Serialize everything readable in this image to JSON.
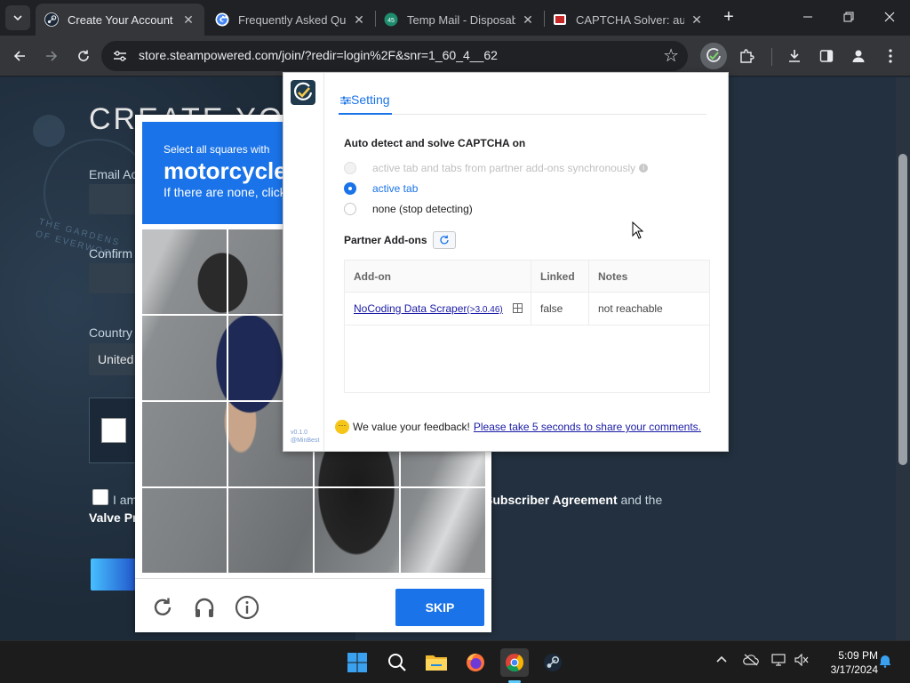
{
  "browser": {
    "tabs": [
      {
        "title": "Create Your Account",
        "active": true
      },
      {
        "title": "Frequently Asked Que",
        "active": false
      },
      {
        "title": "Temp Mail - Disposab",
        "active": false
      },
      {
        "title": "CAPTCHA Solver: auto",
        "active": false
      }
    ],
    "new_tab_symbol": "+",
    "url": "store.steampowered.com/join/?redir=login%2F&snr=1_60_4__62"
  },
  "page": {
    "title": "CREATE YOU",
    "email_label": "Email Ac",
    "confirm_label": "Confirm",
    "country_label": "Country",
    "country_value": "United",
    "agree_prefix": "I am",
    "agree_middle": "Subscriber Agreement",
    "agree_suffix": "and the",
    "agree_line2": "Valve Pr",
    "watermark": "THE GARDENS OF EVERWOOD"
  },
  "hcaptcha": {
    "prompt_small": "Select all squares with",
    "prompt_object": "motorcycle",
    "prompt_hint": "If there are none, click",
    "skip_label": "SKIP"
  },
  "extension": {
    "tab_label": "Setting",
    "version": "v0.1.0 @MinBest",
    "auto_detect_title": "Auto detect and solve CAPTCHA on",
    "options": [
      {
        "label": "active tab and tabs from partner add-ons synchronously",
        "state": "disabled"
      },
      {
        "label": "active tab",
        "state": "selected"
      },
      {
        "label": "none (stop detecting)",
        "state": "normal"
      }
    ],
    "partner_title": "Partner Add-ons",
    "table": {
      "headers": [
        "Add-on",
        "Linked",
        "Notes"
      ],
      "rows": [
        {
          "addon": "NoCoding Data Scraper",
          "version": "(>3.0.46)",
          "linked": "false",
          "notes": "not reachable"
        }
      ]
    },
    "feedback_text": "We value your feedback!",
    "feedback_link": "Please take 5 seconds to share your comments."
  },
  "taskbar": {
    "time": "5:09 PM",
    "date": "3/17/2024"
  },
  "colors": {
    "accent": "#1a73e8",
    "steam_bg": "#1b2838",
    "chrome_dark": "#202124"
  }
}
